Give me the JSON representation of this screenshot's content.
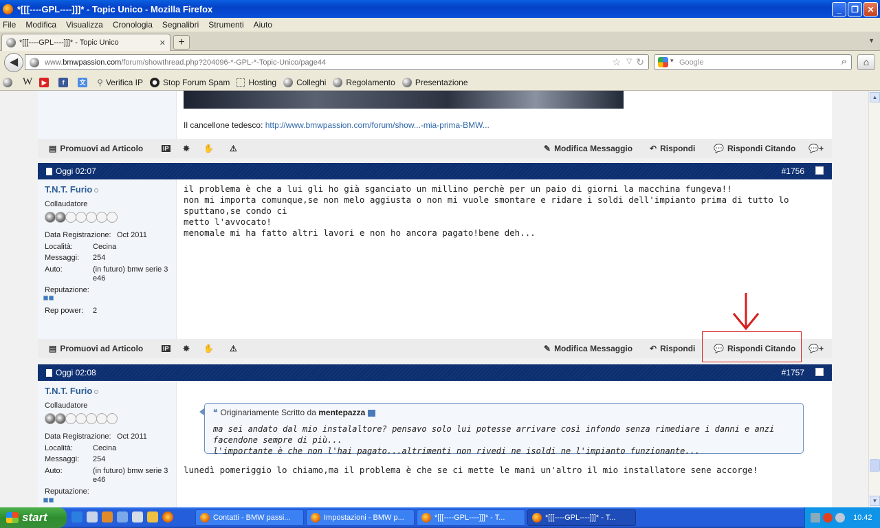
{
  "window": {
    "title": "*[[[----GPL----]]]* - Topic Unico - Mozilla Firefox"
  },
  "menu": [
    "File",
    "Modifica",
    "Visualizza",
    "Cronologia",
    "Segnalibri",
    "Strumenti",
    "Aiuto"
  ],
  "tab": {
    "label": "*[[[----GPL----]]]* - Topic Unico"
  },
  "url": {
    "prefix": "www.",
    "domain": "bmwpassion.com",
    "path": "/forum/showthread.php?204096-*-GPL-*-Topic-Unico/page44"
  },
  "search": {
    "placeholder": "Google"
  },
  "bookmarks": [
    {
      "label": "Verifica IP"
    },
    {
      "label": "Stop Forum Spam"
    },
    {
      "label": "Hosting"
    },
    {
      "label": "Colleghi"
    },
    {
      "label": "Regolamento"
    },
    {
      "label": "Presentazione"
    }
  ],
  "post_top": {
    "text": "Il cancellone tedesco: ",
    "link": "http://www.bmwpassion.com/forum/show...-mia-prima-BMW..."
  },
  "actions": {
    "promuovi": "Promuovi ad Articolo",
    "modifica": "Modifica Messaggio",
    "rispondi": "Rispondi",
    "rispondi_citando": "Rispondi Citando"
  },
  "posts": [
    {
      "date": "Oggi 02:07",
      "num": "#1756",
      "user": "T.N.T. Furio",
      "rank": "Collaudatore",
      "reg_label": "Data Registrazione:",
      "reg": "Oct 2011",
      "loc_label": "Località:",
      "loc": "Cecina",
      "msgs_label": "Messaggi:",
      "msgs": "254",
      "auto_label": "Auto:",
      "auto": "(in futuro) bmw serie 3 e46",
      "rep_label": "Reputazione:",
      "power_label": "Rep power:",
      "power": "2",
      "lines": [
        "il problema è che a lui gli ho già sganciato un millino perchè per un paio di giorni la macchina fungeva!!",
        "non mi importa comunque,se non melo aggiusta o non mi vuole smontare e ridare i soldi dell'impianto prima di tutto lo sputtano,se condo ci",
        "metto l'avvocato!",
        "menomale mi ha fatto altri lavori e non ho ancora pagato!bene deh..."
      ]
    },
    {
      "date": "Oggi 02:08",
      "num": "#1757",
      "user": "T.N.T. Furio",
      "rank": "Collaudatore",
      "reg_label": "Data Registrazione:",
      "reg": "Oct 2011",
      "loc_label": "Località:",
      "loc": "Cecina",
      "msgs_label": "Messaggi:",
      "msgs": "254",
      "auto_label": "Auto:",
      "auto": "(in futuro) bmw serie 3 e46",
      "rep_label": "Reputazione:",
      "quote_prefix": "Originariamente Scritto da",
      "quote_author": "mentepazza",
      "quote_lines": [
        "ma sei andato dal mio instalaltore? pensavo solo lui potesse arrivare così infondo senza rimediare i danni e anzi facendone sempre di più...",
        "l'importante è che non l'hai pagato...altrimenti non rivedi ne isoldi ne l'impianto funzionante..."
      ],
      "text": "lunedì pomeriggio lo chiamo,ma il problema è che se ci mette le mani un'altro il mio installatore sene accorge!"
    }
  ],
  "taskbar": {
    "start": "start",
    "tasks": [
      "Contatti - BMW passi...",
      "Impostazioni - BMW p...",
      "*[[[----GPL----]]]* - T...",
      "*[[[----GPL----]]]* - T..."
    ],
    "clock": "10.42"
  },
  "colors": {
    "accent": "#0d2e6e",
    "link": "#2d5e96",
    "highlight": "#d62020"
  }
}
